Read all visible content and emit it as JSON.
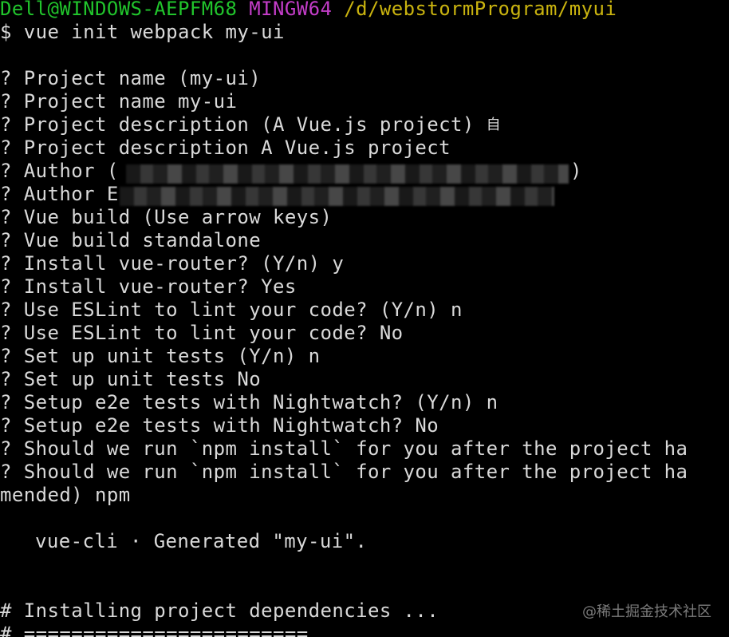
{
  "prompt": {
    "user_host": "Dell@WINDOWS-AEPFM68",
    "env": "MINGW64",
    "path": "/d/webstormProgram/myui"
  },
  "command": "$ vue init webpack my-ui",
  "qa": [
    "? Project name (my-ui)",
    "? Project name my-ui",
    "? Project description (A Vue.js project)",
    "? Project description A Vue.js project",
    "? Author (",
    "? Author E",
    "? Vue build (Use arrow keys)",
    "? Vue build standalone",
    "? Install vue-router? (Y/n) y",
    "? Install vue-router? Yes",
    "? Use ESLint to lint your code? (Y/n) n",
    "? Use ESLint to lint your code? No",
    "? Set up unit tests (Y/n) n",
    "? Set up unit tests No",
    "? Setup e2e tests with Nightwatch? (Y/n) n",
    "? Setup e2e tests with Nightwatch? No",
    "? Should we run `npm install` for you after the project ha",
    "? Should we run `npm install` for you after the project ha",
    "mended) npm"
  ],
  "desc_trailing_char": "自",
  "author_close": ")",
  "generated": "vue-cli · Generated \"my-ui\".",
  "installing": "# Installing project dependencies ...",
  "separator": "# ========================",
  "watermark": "@稀土掘金技术社区"
}
